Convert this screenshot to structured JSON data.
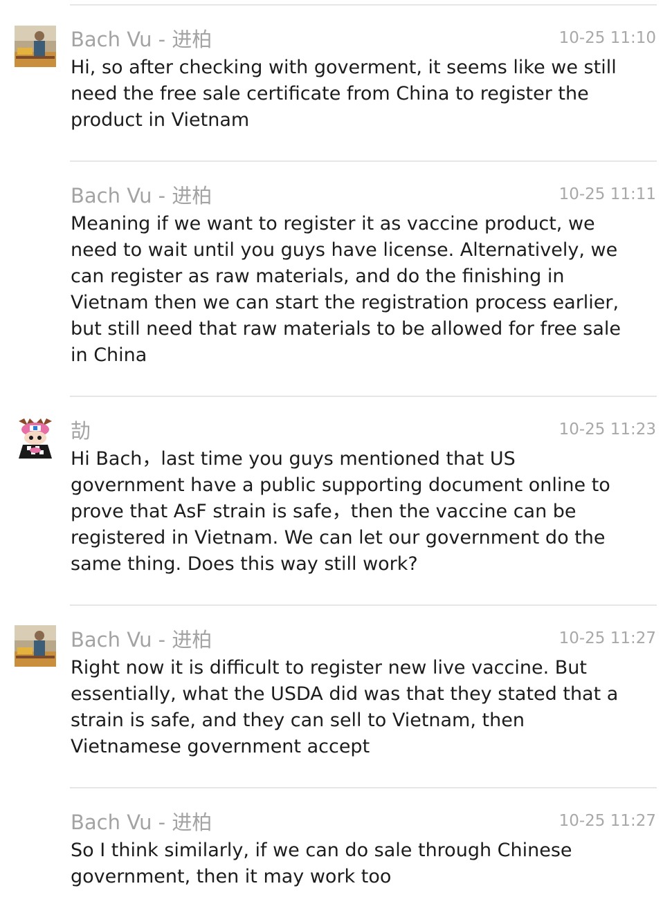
{
  "messages": [
    {
      "sender": "Bach Vu - 进柏",
      "time": "10-25 11:10",
      "avatar": "photo-avatar-man",
      "lines": [
        "Hi, so after checking with goverment, it seems like we still",
        "need the free sale certificate from China to register the",
        "product in Vietnam"
      ]
    },
    {
      "sender": "Bach Vu - 进柏",
      "time": "10-25 11:11",
      "avatar": "",
      "lines": [
        "Meaning if we want to register it as vaccine product, we",
        "need to wait until you guys have license. Alternatively, we",
        "can register as raw materials, and do the finishing in",
        "Vietnam then we can start the registration process earlier,",
        "but still need that raw materials to be allowed for free sale",
        "in China"
      ]
    },
    {
      "sender": "劼",
      "time": "10-25 11:23",
      "avatar": "cartoon-avatar",
      "lines": [
        "Hi Bach，last time you guys mentioned that US",
        "government have a public supporting document online to",
        "prove that AsF strain is safe，then the vaccine can be",
        "registered in Vietnam.  We can let our government do the",
        "same thing. Does this way still work?"
      ]
    },
    {
      "sender": "Bach Vu - 进柏",
      "time": "10-25 11:27",
      "avatar": "photo-avatar-man",
      "lines": [
        "Right now it is difficult to register new live vaccine. But",
        "essentially, what the USDA did was that they stated that a",
        "strain is safe, and they can sell to Vietnam, then",
        "Vietnamese government accept"
      ]
    },
    {
      "sender": "Bach Vu - 进柏",
      "time": "10-25 11:27",
      "avatar": "",
      "lines": [
        "So I think similarly, if we can do sale through Chinese",
        "government, then it may work too"
      ]
    }
  ]
}
